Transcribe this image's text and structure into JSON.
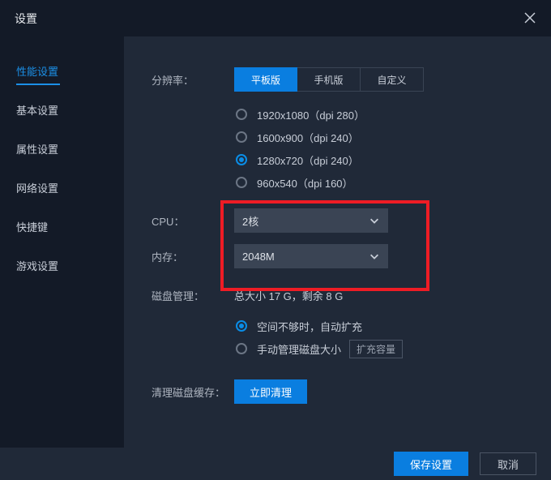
{
  "window": {
    "title": "设置"
  },
  "sidebar": {
    "items": [
      {
        "label": "性能设置",
        "active": true
      },
      {
        "label": "基本设置",
        "active": false
      },
      {
        "label": "属性设置",
        "active": false
      },
      {
        "label": "网络设置",
        "active": false
      },
      {
        "label": "快捷键",
        "active": false
      },
      {
        "label": "游戏设置",
        "active": false
      }
    ]
  },
  "labels": {
    "resolution": "分辨率：",
    "cpu": "CPU：",
    "memory": "内存：",
    "disk": "磁盘管理：",
    "clean": "清理磁盘缓存："
  },
  "resolution": {
    "tabs": [
      {
        "label": "平板版",
        "active": true
      },
      {
        "label": "手机版",
        "active": false
      },
      {
        "label": "自定义",
        "active": false
      }
    ],
    "options": [
      {
        "label": "1920x1080（dpi 280）",
        "checked": false
      },
      {
        "label": "1600x900（dpi 240）",
        "checked": false
      },
      {
        "label": "1280x720（dpi 240）",
        "checked": true
      },
      {
        "label": "960x540（dpi 160）",
        "checked": false
      }
    ]
  },
  "cpu": {
    "value": "2核"
  },
  "memory": {
    "value": "2048M"
  },
  "disk": {
    "summary": "总大小 17 G，剩余 8 G",
    "auto": {
      "label": "空间不够时，自动扩充",
      "checked": true
    },
    "manual": {
      "label": "手动管理磁盘大小",
      "checked": false,
      "button": "扩充容量"
    }
  },
  "clean": {
    "button": "立即清理"
  },
  "footer": {
    "save": "保存设置",
    "cancel": "取消"
  }
}
